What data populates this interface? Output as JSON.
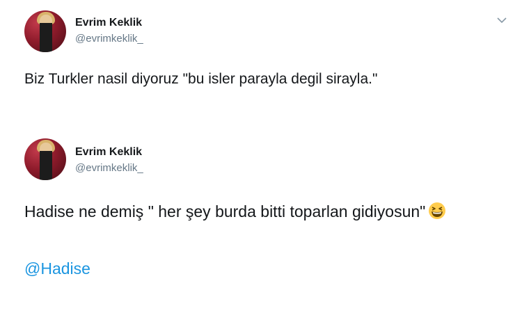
{
  "tweets": [
    {
      "display_name": "Evrim Keklik",
      "handle": "@evrimkeklik_",
      "text": "Biz Turkler nasil diyoruz \"bu isler parayla degil sirayla.\"",
      "menu_icon": "chevron-down-icon"
    },
    {
      "display_name": "Evrim Keklik",
      "handle": "@evrimkeklik_",
      "text": "Hadise ne demiş \" her şey burda bitti toparlan gidiyosun\"",
      "emoji": "grinning-squinting-face-icon",
      "mention": "@Hadise"
    }
  ],
  "colors": {
    "text": "#14171a",
    "handle": "#657786",
    "link": "#1b95e0"
  }
}
